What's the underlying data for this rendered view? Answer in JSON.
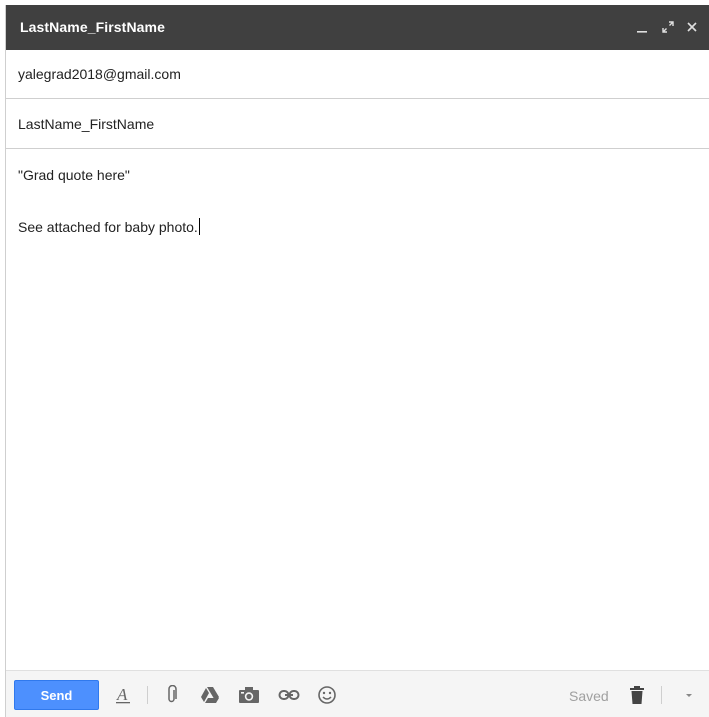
{
  "window": {
    "title": "LastName_FirstName",
    "minimize_icon": "minimize-icon",
    "expand_icon": "expand-icon",
    "close_icon": "close-icon"
  },
  "fields": {
    "recipient": "yalegrad2018@gmail.com",
    "subject": "LastName_FirstName"
  },
  "body": {
    "line1": "\"Grad quote here\"",
    "line2": "See attached for baby photo."
  },
  "toolbar": {
    "send_label": "Send",
    "saved_label": "Saved",
    "icons": [
      "format-text-icon",
      "attach-icon",
      "drive-icon",
      "photo-icon",
      "link-icon",
      "emoji-icon",
      "trash-icon",
      "more-options-icon"
    ]
  },
  "colors": {
    "titlebar_bg": "#404040",
    "send_bg": "#4d90fe",
    "toolbar_bg": "#f5f5f5"
  }
}
